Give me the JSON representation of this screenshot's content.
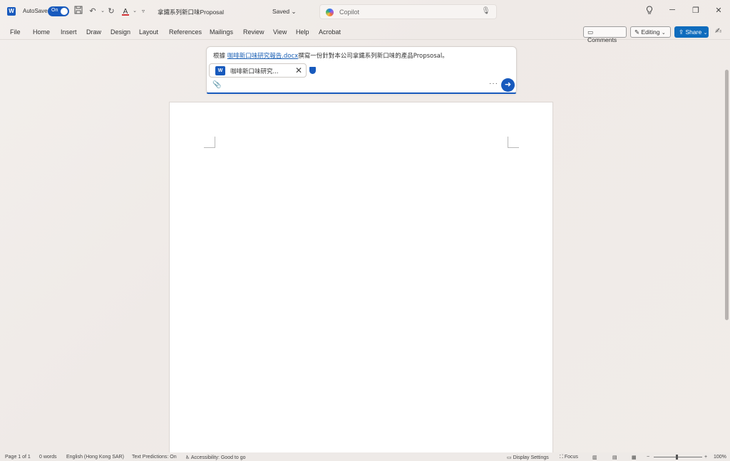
{
  "titlebar": {
    "autosave_label": "AutoSave",
    "autosave_state": "On",
    "doc_title": "拿鐵系列新口味Proposal",
    "saved_status": "Saved",
    "search_placeholder": "Copilot",
    "icons": [
      "word-logo",
      "save-icon",
      "undo-icon",
      "redo-icon",
      "font-color-icon",
      "customize-qat-icon",
      "lightbulb-icon",
      "minimize-icon",
      "restore-icon",
      "close-icon"
    ]
  },
  "menubar": {
    "items": [
      "File",
      "Home",
      "Insert",
      "Draw",
      "Design",
      "Layout",
      "References",
      "Mailings",
      "Review",
      "View",
      "Help",
      "Acrobat"
    ],
    "comments_label": "Comments",
    "editing_label": "Editing",
    "share_label": "Share"
  },
  "copilot": {
    "prompt_before": "根據 ",
    "prompt_ref": "咖啡新口味研究報告.docx",
    "prompt_after": "撰寫一份針對本公司拿鐵系列新口味的產品Propsosal。",
    "file_chip_name": "咖啡新口味研究...",
    "send_icon": "arrow-right-icon",
    "accent": "#185abd"
  },
  "statusbar": {
    "page": "Page 1 of 1",
    "words": "0 words",
    "language": "English (Hong Kong SAR)",
    "text_predictions": "Text Predictions: On",
    "accessibility": "Accessibility: Good to go",
    "display_settings": "Display Settings",
    "focus": "Focus",
    "zoom": "100%"
  }
}
